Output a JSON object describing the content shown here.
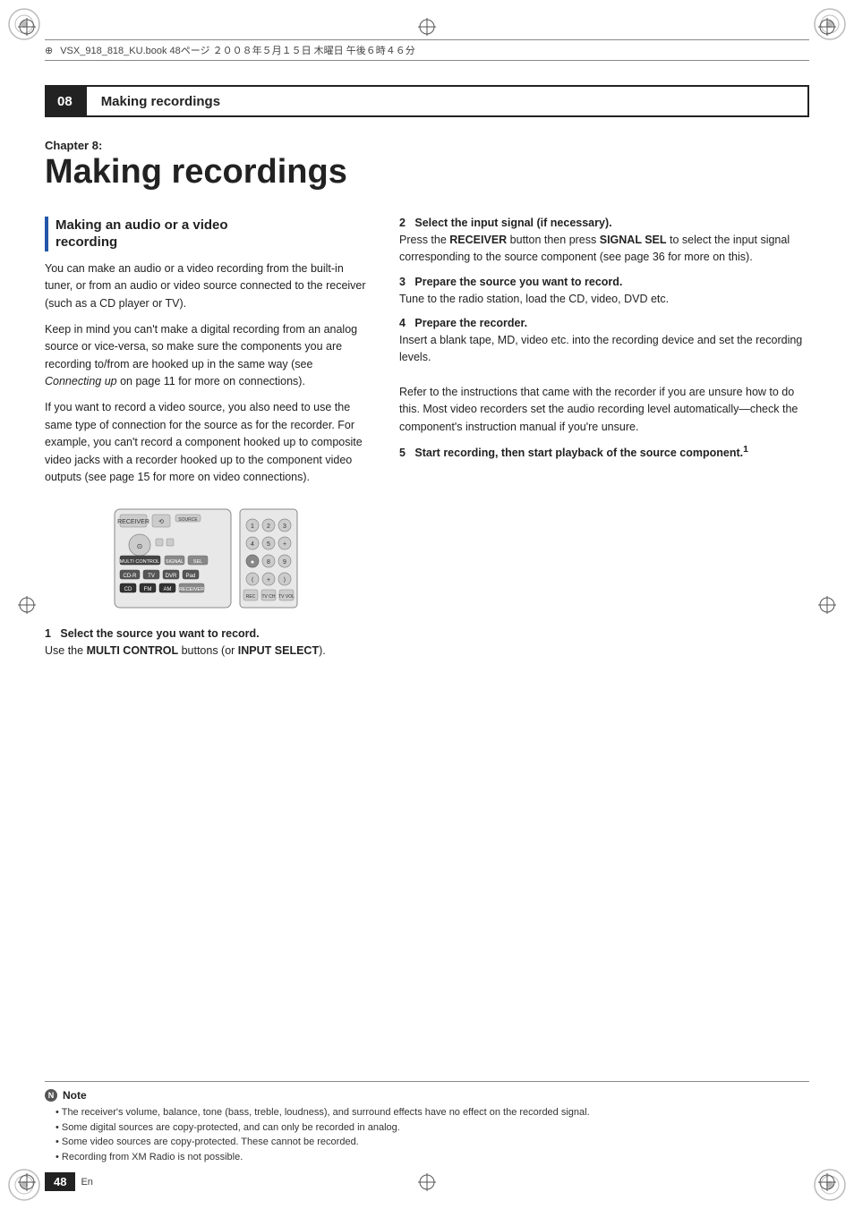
{
  "page": {
    "file_info": "VSX_918_818_KU.book  48ページ  ２００８年５月１５日  木曜日  午後６時４６分",
    "chapter_number": "08",
    "chapter_title": "Making recordings",
    "big_chapter_label": "Chapter 8:",
    "big_chapter_title": "Making recordings",
    "page_number": "48",
    "page_lang": "En"
  },
  "note": {
    "label": "Note",
    "bullets": [
      "The receiver's volume, balance, tone (bass, treble, loudness), and surround effects have no effect on the recorded signal.",
      "Some digital sources are copy-protected, and can only be recorded in analog.",
      "Some video sources are copy-protected. These cannot be recorded.",
      "Recording from XM Radio is not possible."
    ]
  },
  "section_left": {
    "heading": "Making an audio or a video\nrecording",
    "paragraphs": [
      "You can make an audio or a video recording from the built-in tuner, or from an audio or video source connected to the receiver (such as a CD player or TV).",
      "Keep in mind you can't make a digital recording from an analog source or vice-versa, so make sure the components you are recording to/from are hooked up in the same way (see Connecting up on page 11 for more on connections).",
      "If you want to record a video source, you also need to use the same type of connection for the source as for the recorder. For example, you can't record a component hooked up to composite video jacks with a recorder hooked up to the component video outputs (see page 15 for more on video connections)."
    ],
    "step1_title": "1   Select the source you want to record.",
    "step1_body": "Use the MULTI CONTROL buttons (or INPUT SELECT)."
  },
  "section_right": {
    "step2_title": "2   Select the input signal (if necessary).",
    "step2_body": "Press the RECEIVER button then press SIGNAL SEL to select the input signal corresponding to the source component (see page 36 for more on this).",
    "step3_title": "3   Prepare the source you want to record.",
    "step3_body": "Tune to the radio station, load the CD, video, DVD etc.",
    "step4_title": "4   Prepare the recorder.",
    "step4_body": "Insert a blank tape, MD, video etc. into the recording device and set the recording levels.\n\nRefer to the instructions that came with the recorder if you are unsure how to do this. Most video recorders set the audio recording level automatically—check the component's instruction manual if you're unsure.",
    "step5_title": "5   Start recording, then start playback of the source component.",
    "step5_superscript": "1"
  }
}
